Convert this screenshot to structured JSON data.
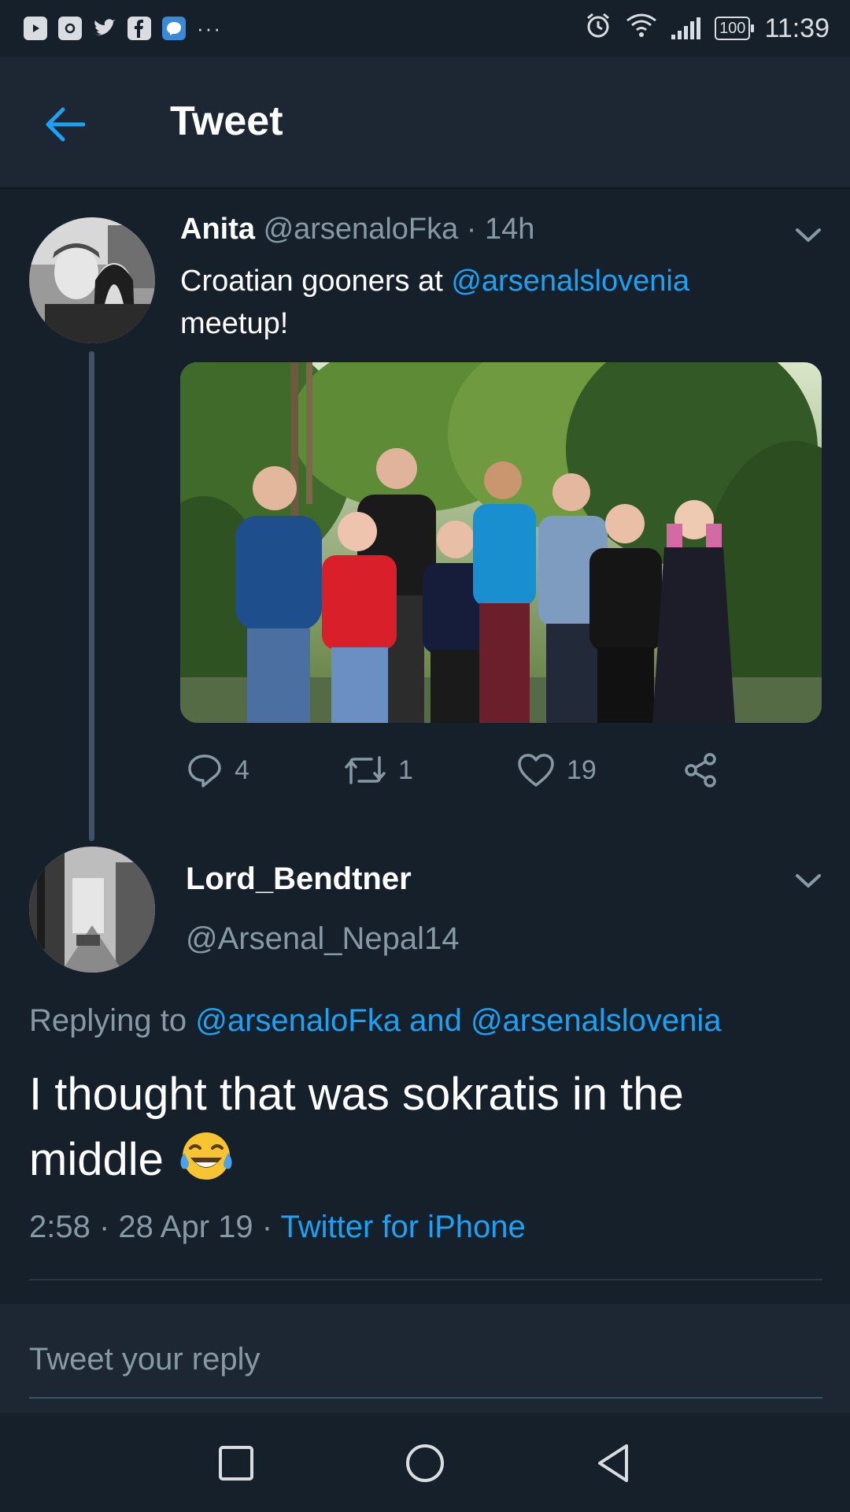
{
  "status_bar": {
    "time": "11:39",
    "battery": "100",
    "notification_icons": [
      "youtube-icon",
      "instagram-icon",
      "twitter-icon",
      "facebook-icon",
      "messenger-icon"
    ],
    "more": "···"
  },
  "header": {
    "title": "Tweet"
  },
  "tweet": {
    "name": "Anita",
    "handle": "@arsenaloFka",
    "separator": " · ",
    "time_ago": "14h",
    "text_before": "Croatian gooners at ",
    "mention": "@arsenalslovenia",
    "text_after": " meetup!",
    "media_alt": "group photo",
    "actions": {
      "replies": "4",
      "retweets": "1",
      "likes": "19"
    }
  },
  "reply_tweet": {
    "name": "Lord_Bendtner",
    "handle": "@Arsenal_Nepal14",
    "replying_prefix": "Replying to ",
    "replying_mention_1": "@arsenaloFka",
    "replying_and": " and ",
    "replying_mention_2": "@arsenalslovenia",
    "text": "I thought that was sokratis in the middle",
    "emoji": "😂",
    "time": "2:58",
    "sep1": " · ",
    "date": "28 Apr 19",
    "sep2": " · ",
    "source": "Twitter for iPhone"
  },
  "reply_bar": {
    "placeholder": "Tweet your reply"
  },
  "colors": {
    "background": "#15202b",
    "header": "#1c2733",
    "accent": "#1da1f2",
    "secondary_text": "#8899a6"
  }
}
